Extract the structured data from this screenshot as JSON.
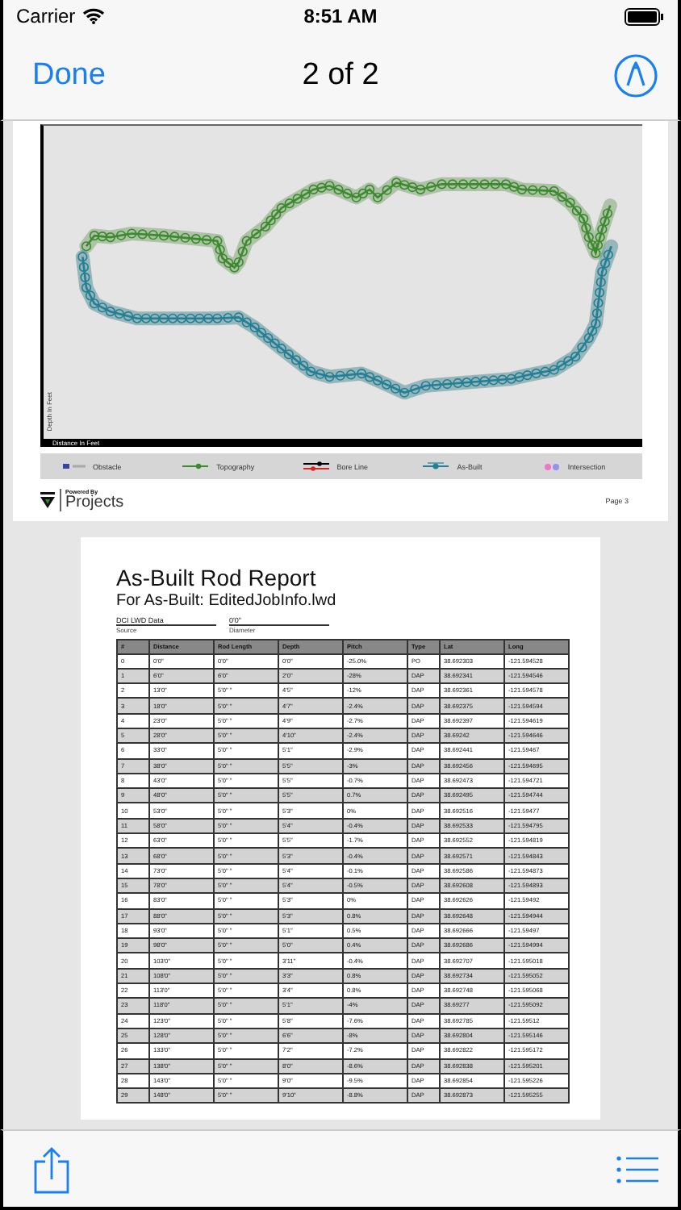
{
  "status_bar": {
    "carrier": "Carrier",
    "time": "8:51 AM"
  },
  "nav_bar": {
    "done": "Done",
    "title": "2 of 2"
  },
  "chart_page": {
    "chart": {
      "xlabel": "Distance In Feet",
      "ylabel": "Depth In Feet"
    },
    "legend": [
      {
        "kind": "obstacle",
        "label": "Obstacle"
      },
      {
        "kind": "topography",
        "label": "Topography"
      },
      {
        "kind": "bore_line",
        "label": "Bore Line"
      },
      {
        "kind": "as_built",
        "label": "As-Built"
      },
      {
        "kind": "intersection",
        "label": "Intersection"
      }
    ],
    "footer": {
      "powered_by": "Powered By",
      "brand": "Projects",
      "page_label": "Page 3"
    }
  },
  "report_page": {
    "title": "As-Built Rod Report",
    "subtitle": "For As-Built: EditedJobInfo.lwd",
    "fields": [
      {
        "value": "DCI LWD Data",
        "label": "Source"
      },
      {
        "value": "0'0\"",
        "label": "Diameter"
      }
    ],
    "table": {
      "columns": [
        "#",
        "Distance",
        "Rod Length",
        "Depth",
        "Pitch",
        "Type",
        "Lat",
        "Long"
      ],
      "rows": [
        [
          "0",
          "0'0\"",
          "0'0\"",
          "0'0\"",
          "-25.0%",
          "PO",
          "38.692303",
          "-121.594528"
        ],
        [
          "1",
          "6'0\"",
          "6'0\"",
          "2'0\"",
          "-28%",
          "DAP",
          "38.692341",
          "-121.594546"
        ],
        [
          "2",
          "13'0\"",
          "5'0\" \"",
          "4'5\"",
          "-12%",
          "DAP",
          "38.692361",
          "-121.594578"
        ],
        [
          "3",
          "18'0\"",
          "5'0\" \"",
          "4'7\"",
          "-2.4%",
          "DAP",
          "38.692375",
          "-121.594594"
        ],
        [
          "4",
          "23'0\"",
          "5'0\" \"",
          "4'9\"",
          "-2.7%",
          "DAP",
          "38.692397",
          "-121.594619"
        ],
        [
          "5",
          "28'0\"",
          "5'0\" \"",
          "4'10\"",
          "-2.4%",
          "DAP",
          "38.69242",
          "-121.594646"
        ],
        [
          "6",
          "33'0\"",
          "5'0\" \"",
          "5'1\"",
          "-2.9%",
          "DAP",
          "38.692441",
          "-121.59467"
        ],
        [
          "7",
          "38'0\"",
          "5'0\" \"",
          "5'5\"",
          "-3%",
          "DAP",
          "38.692456",
          "-121.594695"
        ],
        [
          "8",
          "43'0\"",
          "5'0\" \"",
          "5'5\"",
          "-0.7%",
          "DAP",
          "38.692473",
          "-121.594721"
        ],
        [
          "9",
          "48'0\"",
          "5'0\" \"",
          "5'5\"",
          "0.7%",
          "DAP",
          "38.692495",
          "-121.594744"
        ],
        [
          "10",
          "53'0\"",
          "5'0\" \"",
          "5'3\"",
          "0%",
          "DAP",
          "38.692516",
          "-121.59477"
        ],
        [
          "11",
          "58'0\"",
          "5'0\" \"",
          "5'4\"",
          "-0.4%",
          "DAP",
          "38.692533",
          "-121.594795"
        ],
        [
          "12",
          "63'0\"",
          "5'0\" \"",
          "5'5\"",
          "-1.7%",
          "DAP",
          "38.692552",
          "-121.594819"
        ],
        [
          "13",
          "68'0\"",
          "5'0\" \"",
          "5'3\"",
          "-0.4%",
          "DAP",
          "38.692571",
          "-121.594843"
        ],
        [
          "14",
          "73'0\"",
          "5'0\" \"",
          "5'4\"",
          "-0.1%",
          "DAP",
          "38.692586",
          "-121.594873"
        ],
        [
          "15",
          "78'0\"",
          "5'0\" \"",
          "5'4\"",
          "-0.5%",
          "DAP",
          "38.692608",
          "-121.594893"
        ],
        [
          "16",
          "83'0\"",
          "5'0\" \"",
          "5'3\"",
          "0%",
          "DAP",
          "38.692626",
          "-121.59492"
        ],
        [
          "17",
          "88'0\"",
          "5'0\" \"",
          "5'3\"",
          "0.8%",
          "DAP",
          "38.692648",
          "-121.594944"
        ],
        [
          "18",
          "93'0\"",
          "5'0\" \"",
          "5'1\"",
          "0.5%",
          "DAP",
          "38.692666",
          "-121.59497"
        ],
        [
          "19",
          "98'0\"",
          "5'0\" \"",
          "5'0\"",
          "0.4%",
          "DAP",
          "38.692686",
          "-121.594994"
        ],
        [
          "20",
          "103'0\"",
          "5'0\" \"",
          "3'11\"",
          "-0.4%",
          "DAP",
          "38.692707",
          "-121.595018"
        ],
        [
          "21",
          "108'0\"",
          "5'0\" \"",
          "3'3\"",
          "0.8%",
          "DAP",
          "38.692734",
          "-121.595052"
        ],
        [
          "22",
          "113'0\"",
          "5'0\" \"",
          "3'4\"",
          "0.8%",
          "DAP",
          "38.692748",
          "-121.595068"
        ],
        [
          "23",
          "118'0\"",
          "5'0\" \"",
          "5'1\"",
          "-4%",
          "DAP",
          "38.69277",
          "-121.595092"
        ],
        [
          "24",
          "123'0\"",
          "5'0\" \"",
          "5'8\"",
          "-7.6%",
          "DAP",
          "38.692785",
          "-121.59512"
        ],
        [
          "25",
          "128'0\"",
          "5'0\" \"",
          "6'6\"",
          "-8%",
          "DAP",
          "38.692804",
          "-121.595146"
        ],
        [
          "26",
          "133'0\"",
          "5'0\" \"",
          "7'2\"",
          "-7.2%",
          "DAP",
          "38.692822",
          "-121.595172"
        ],
        [
          "27",
          "138'0\"",
          "5'0\" \"",
          "8'0\"",
          "-8.6%",
          "DAP",
          "38.692838",
          "-121.595201"
        ],
        [
          "28",
          "143'0\"",
          "5'0\" \"",
          "9'0\"",
          "-9.5%",
          "DAP",
          "38.692854",
          "-121.595226"
        ],
        [
          "29",
          "148'0\"",
          "5'0\" \"",
          "9'10\"",
          "-8.8%",
          "DAP",
          "38.692873",
          "-121.595255"
        ]
      ]
    }
  }
}
